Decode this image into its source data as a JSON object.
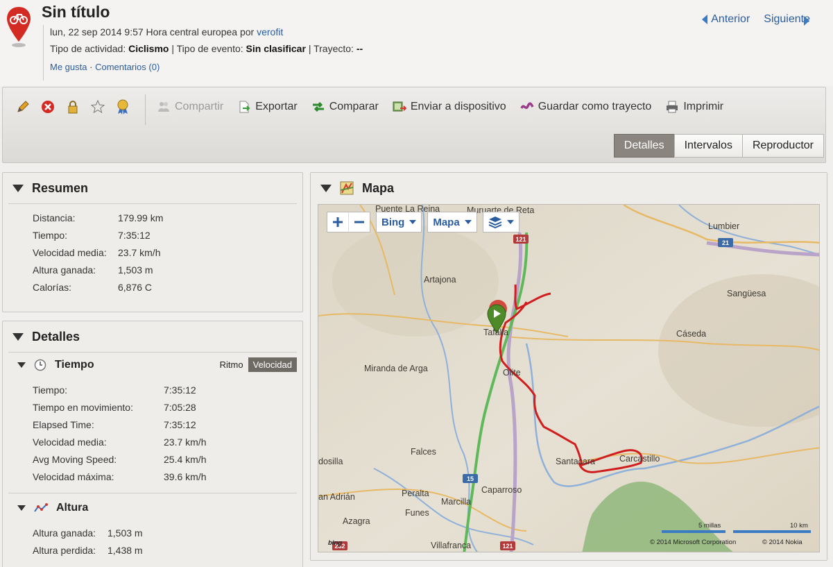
{
  "header": {
    "title": "Sin título",
    "date_line": "lun, 22 sep 2014 9:57 Hora central europea por",
    "author": "verofit",
    "activity_label": "Tipo de actividad:",
    "activity_value": "Ciclismo",
    "event_label": "Tipo de evento:",
    "event_value": "Sin clasificar",
    "course_label": "Trayecto:",
    "course_value": "--",
    "separator": "|",
    "like": "Me gusta",
    "dot": "·",
    "comments": "Comentarios (0)"
  },
  "nav": {
    "prev": "Anterior",
    "next": "Siguiente"
  },
  "toolbar": {
    "actions": [
      {
        "label": "Compartir",
        "icon": "share-icon"
      },
      {
        "label": "Exportar",
        "icon": "export-icon"
      },
      {
        "label": "Comparar",
        "icon": "compare-icon"
      },
      {
        "label": "Enviar a dispositivo",
        "icon": "send-device-icon"
      },
      {
        "label": "Guardar como trayecto",
        "icon": "save-course-icon"
      },
      {
        "label": "Imprimir",
        "icon": "print-icon"
      }
    ],
    "tabs": [
      "Detalles",
      "Intervalos",
      "Reproductor"
    ]
  },
  "resumen": {
    "title": "Resumen",
    "rows": [
      {
        "k": "Distancia:",
        "v": "179.99 km"
      },
      {
        "k": "Tiempo:",
        "v": "7:35:12"
      },
      {
        "k": "Velocidad media:",
        "v": "23.7 km/h"
      },
      {
        "k": "Altura ganada:",
        "v": "1,503 m"
      },
      {
        "k": "Calorías:",
        "v": "6,876 C"
      }
    ]
  },
  "detalles": {
    "title": "Detalles",
    "tiempo_title": "Tiempo",
    "toggle": {
      "ritmo": "Ritmo",
      "velocidad": "Velocidad"
    },
    "tiempo_rows": [
      {
        "k": "Tiempo:",
        "v": "7:35:12"
      },
      {
        "k": "Tiempo en movimiento:",
        "v": "7:05:28"
      },
      {
        "k": "Elapsed Time:",
        "v": "7:35:12"
      },
      {
        "k": "Velocidad media:",
        "v": "23.7 km/h"
      },
      {
        "k": "Avg Moving Speed:",
        "v": "25.4 km/h"
      },
      {
        "k": "Velocidad máxima:",
        "v": "39.6 km/h"
      }
    ],
    "altura_title": "Altura",
    "altura_rows": [
      {
        "k": "Altura ganada:",
        "v": "1,503 m"
      },
      {
        "k": "Altura perdida:",
        "v": "1,438 m"
      }
    ]
  },
  "mapa": {
    "title": "Mapa",
    "provider": "Bing",
    "map_type": "Mapa",
    "towns": [
      "Puente La Reina",
      "Muruarte de Reta",
      "Lumbier",
      "Artajona",
      "Sangüesa",
      "Tafalla",
      "Cáseda",
      "Miranda de Arga",
      "Olite",
      "Falces",
      "Santacara",
      "Carcastillo",
      "dosilla",
      "Peralta",
      "Marcilla",
      "Caparroso",
      "an Adrián",
      "Funes",
      "Azagra",
      "Villafranca"
    ],
    "roads": [
      "121",
      "21",
      "15",
      "232",
      "121"
    ],
    "scale_miles": "5 millas",
    "scale_km": "10 km",
    "copyright": "© 2014 Microsoft Corporation",
    "copyright2": "© 2014 Nokia",
    "bing": "bing"
  }
}
